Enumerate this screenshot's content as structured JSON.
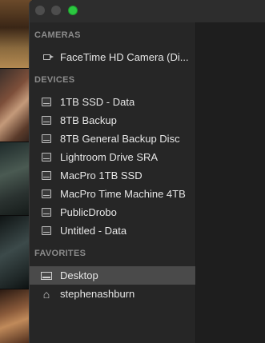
{
  "sidebar": {
    "cameras_header": "CAMERAS",
    "devices_header": "DEVICES",
    "favorites_header": "FAVORITES",
    "cameras": [
      {
        "label": "FaceTime HD Camera (Di...",
        "icon": "camera-icon"
      }
    ],
    "devices": [
      {
        "label": "1TB SSD - Data",
        "icon": "drive-icon"
      },
      {
        "label": "8TB Backup",
        "icon": "drive-icon"
      },
      {
        "label": "8TB General Backup Disc",
        "icon": "drive-icon"
      },
      {
        "label": "Lightroom Drive SRA",
        "icon": "drive-icon"
      },
      {
        "label": "MacPro 1TB SSD",
        "icon": "drive-icon"
      },
      {
        "label": "MacPro Time Machine 4TB",
        "icon": "drive-icon"
      },
      {
        "label": "PublicDrobo",
        "icon": "drive-icon"
      },
      {
        "label": "Untitled - Data",
        "icon": "drive-icon"
      }
    ],
    "favorites": [
      {
        "label": "Desktop",
        "icon": "desktop-icon",
        "selected": true
      },
      {
        "label": "stephenashburn",
        "icon": "home-icon",
        "selected": false
      }
    ]
  },
  "colors": {
    "sidebar_bg": "#262626",
    "selection": "#4a4a4a",
    "zoom_button": "#2bc840"
  }
}
